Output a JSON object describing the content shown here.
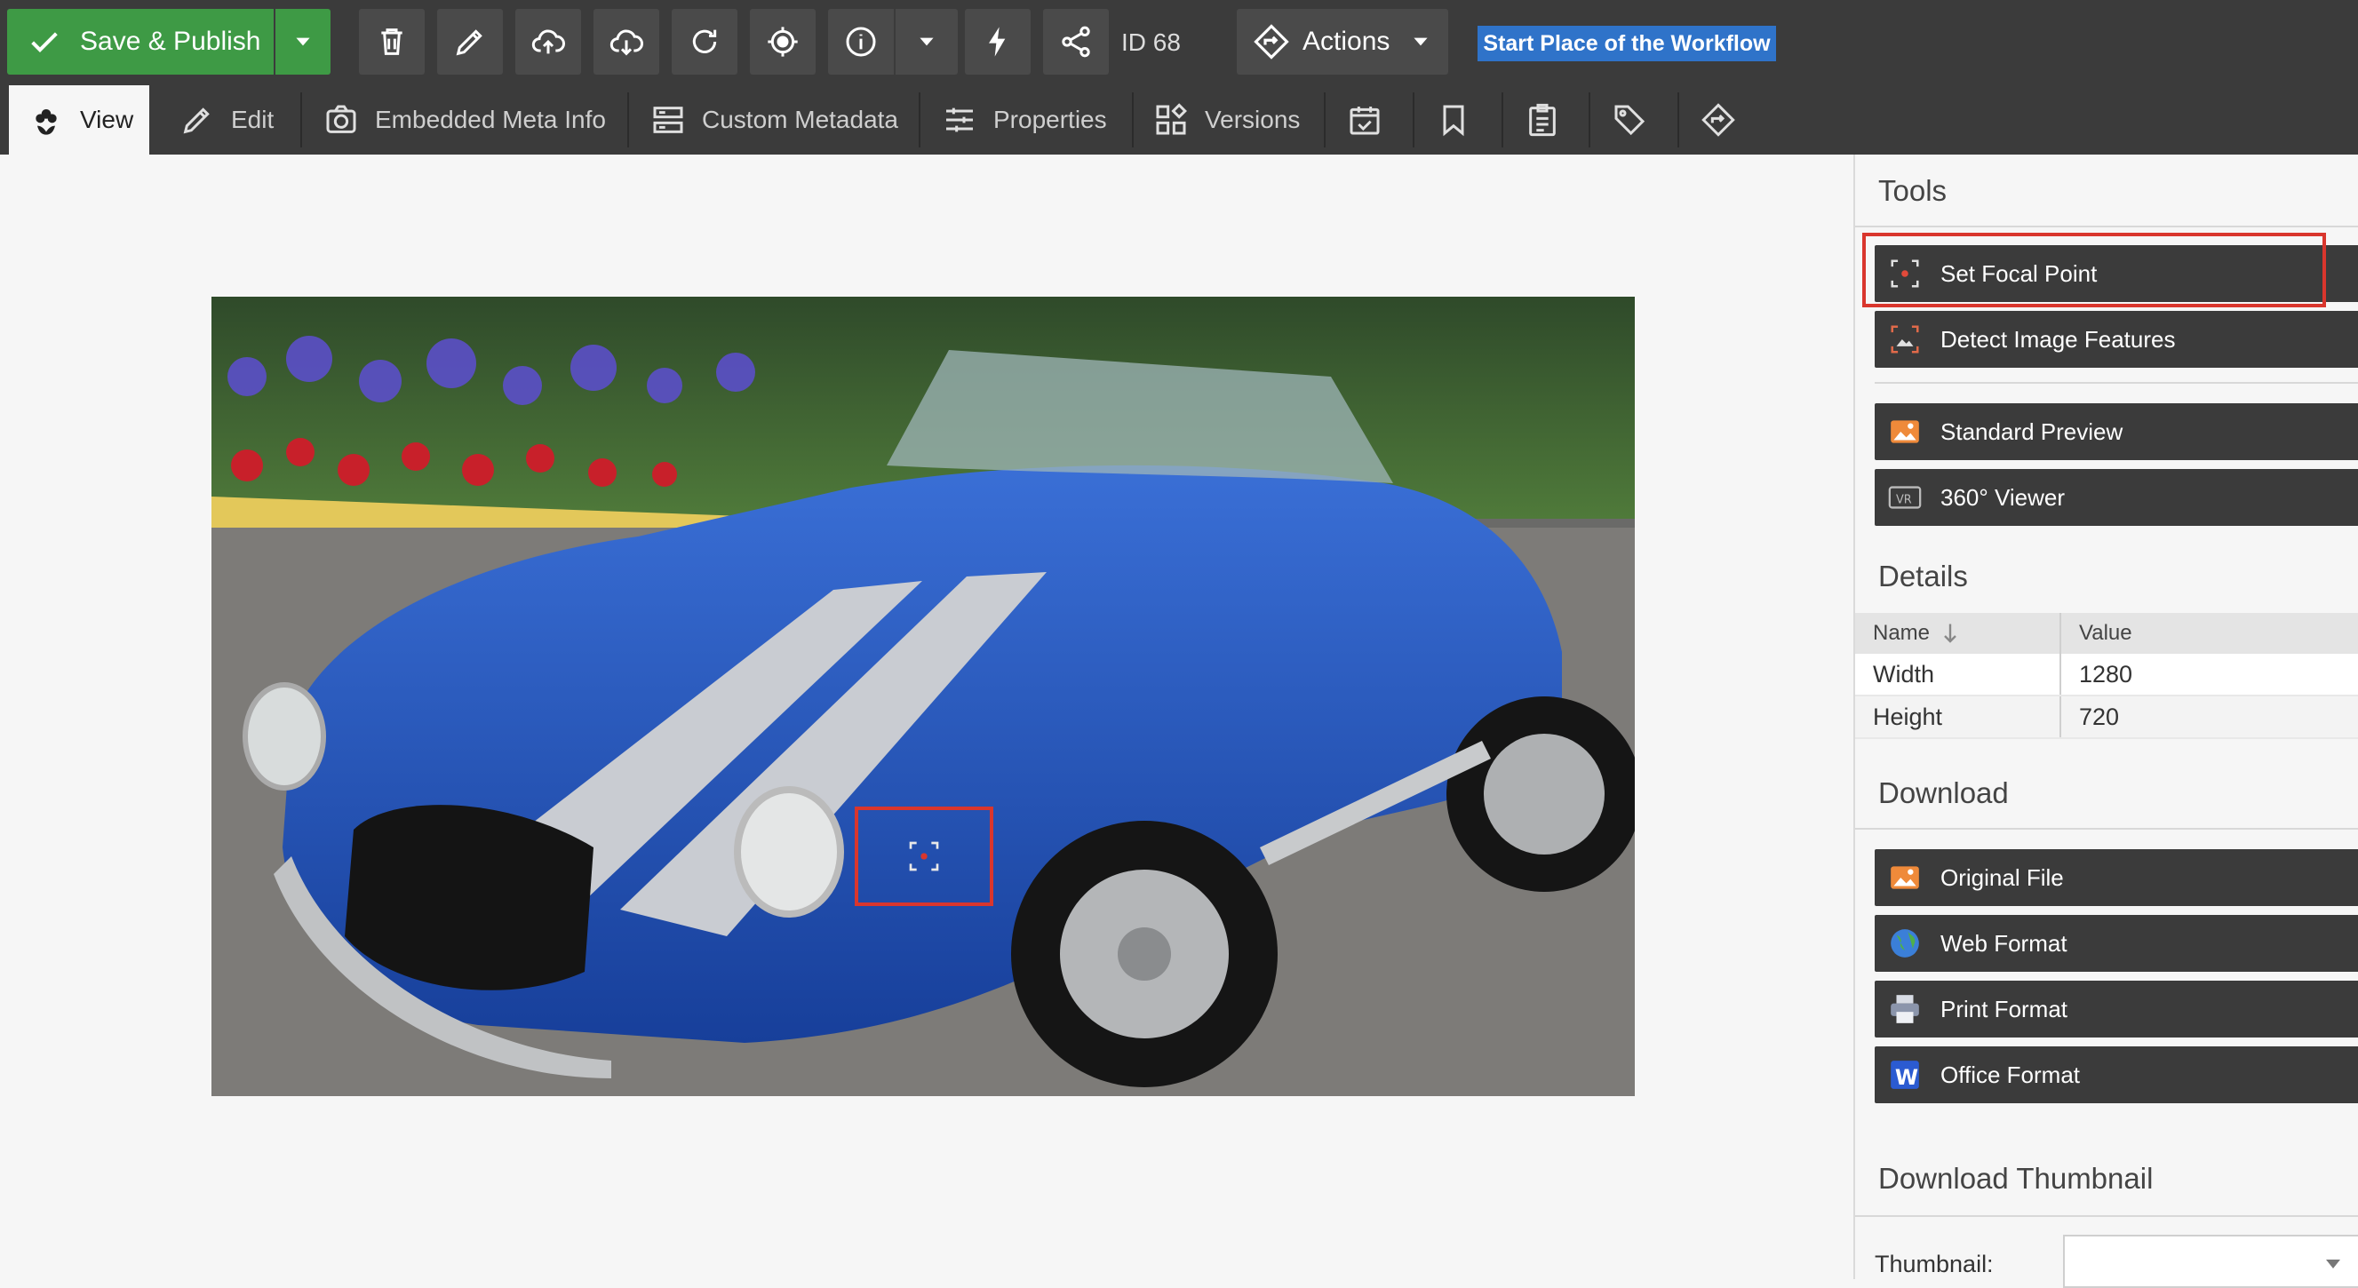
{
  "toolbar": {
    "save_label": "Save & Publish",
    "id_label": "ID 68",
    "actions_label": "Actions",
    "workflow_badge": "Start Place of the Workflow"
  },
  "tabs": [
    {
      "label": "View",
      "icon": "flower-icon"
    },
    {
      "label": "Edit",
      "icon": "pencil-icon"
    },
    {
      "label": "Embedded Meta Info",
      "icon": "camera-icon"
    },
    {
      "label": "Custom Metadata",
      "icon": "metadata-icon"
    },
    {
      "label": "Properties",
      "icon": "sliders-icon"
    },
    {
      "label": "Versions",
      "icon": "versions-icon"
    }
  ],
  "sidebar": {
    "tools_title": "Tools",
    "tools": [
      {
        "label": "Set Focal Point"
      },
      {
        "label": "Detect Image Features"
      },
      {
        "label": "Standard Preview"
      },
      {
        "label": "360° Viewer"
      }
    ],
    "details_title": "Details",
    "details_columns": [
      "Name",
      "Value"
    ],
    "details_rows": [
      {
        "name": "Width",
        "value": "1280"
      },
      {
        "name": "Height",
        "value": "720"
      }
    ],
    "download_title": "Download",
    "downloads": [
      {
        "label": "Original File"
      },
      {
        "label": "Web Format"
      },
      {
        "label": "Print Format"
      },
      {
        "label": "Office Format"
      }
    ],
    "thumb_title": "Download Thumbnail",
    "thumb_label": "Thumbnail:"
  },
  "colors": {
    "accent_green": "#3e9a45",
    "toolbar_dark": "#3b3b3b",
    "highlight_red": "#d9362d",
    "workflow_blue": "#2f73c9"
  }
}
